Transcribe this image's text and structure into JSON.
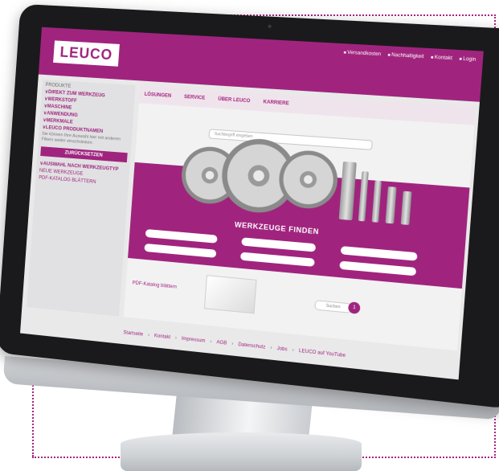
{
  "brand": {
    "logo_text": "LEUCO",
    "accent_color": "#a0247e"
  },
  "topnav": [
    "Versandkosten",
    "Nachhaltigkeit",
    "Kontakt",
    "Login"
  ],
  "sidebar": {
    "section_title": "PRODUKTE",
    "items": [
      {
        "label": "DIREKT ZUM WERKZEUG"
      },
      {
        "label": "WERKSTOFF"
      },
      {
        "label": "MASCHINE"
      },
      {
        "label": "ANWENDUNG"
      },
      {
        "label": "MERKMALE"
      },
      {
        "label": "LEUCO PRODUKTNAMEN"
      }
    ],
    "hint_text": "Sie können Ihre Auswahl hier mit anderen Filtern weiter einschränken.",
    "reset_label": "ZURÜCKSETZEN",
    "selection_label": "AUSWAHL NACH WERKZEUGTYP",
    "links": [
      "NEUE WERKZEUGE",
      "PDF-KATALOG BLÄTTERN"
    ]
  },
  "content": {
    "tabs": [
      "LÖSUNGEN",
      "SERVICE",
      "ÜBER LEUCO",
      "KARRIERE"
    ],
    "search_placeholder": "Suchbegriff eingeben",
    "hero_title": "WERKZEUGE FINDEN",
    "catalog_link": "PDF-Katalog blättern",
    "search_button": "Suchen",
    "badge_count": "1"
  },
  "footer": {
    "links": [
      "Startseite",
      "Kontakt",
      "Impressum",
      "AGB",
      "Datenschutz",
      "Jobs",
      "LEUCO auf YouTube"
    ]
  }
}
